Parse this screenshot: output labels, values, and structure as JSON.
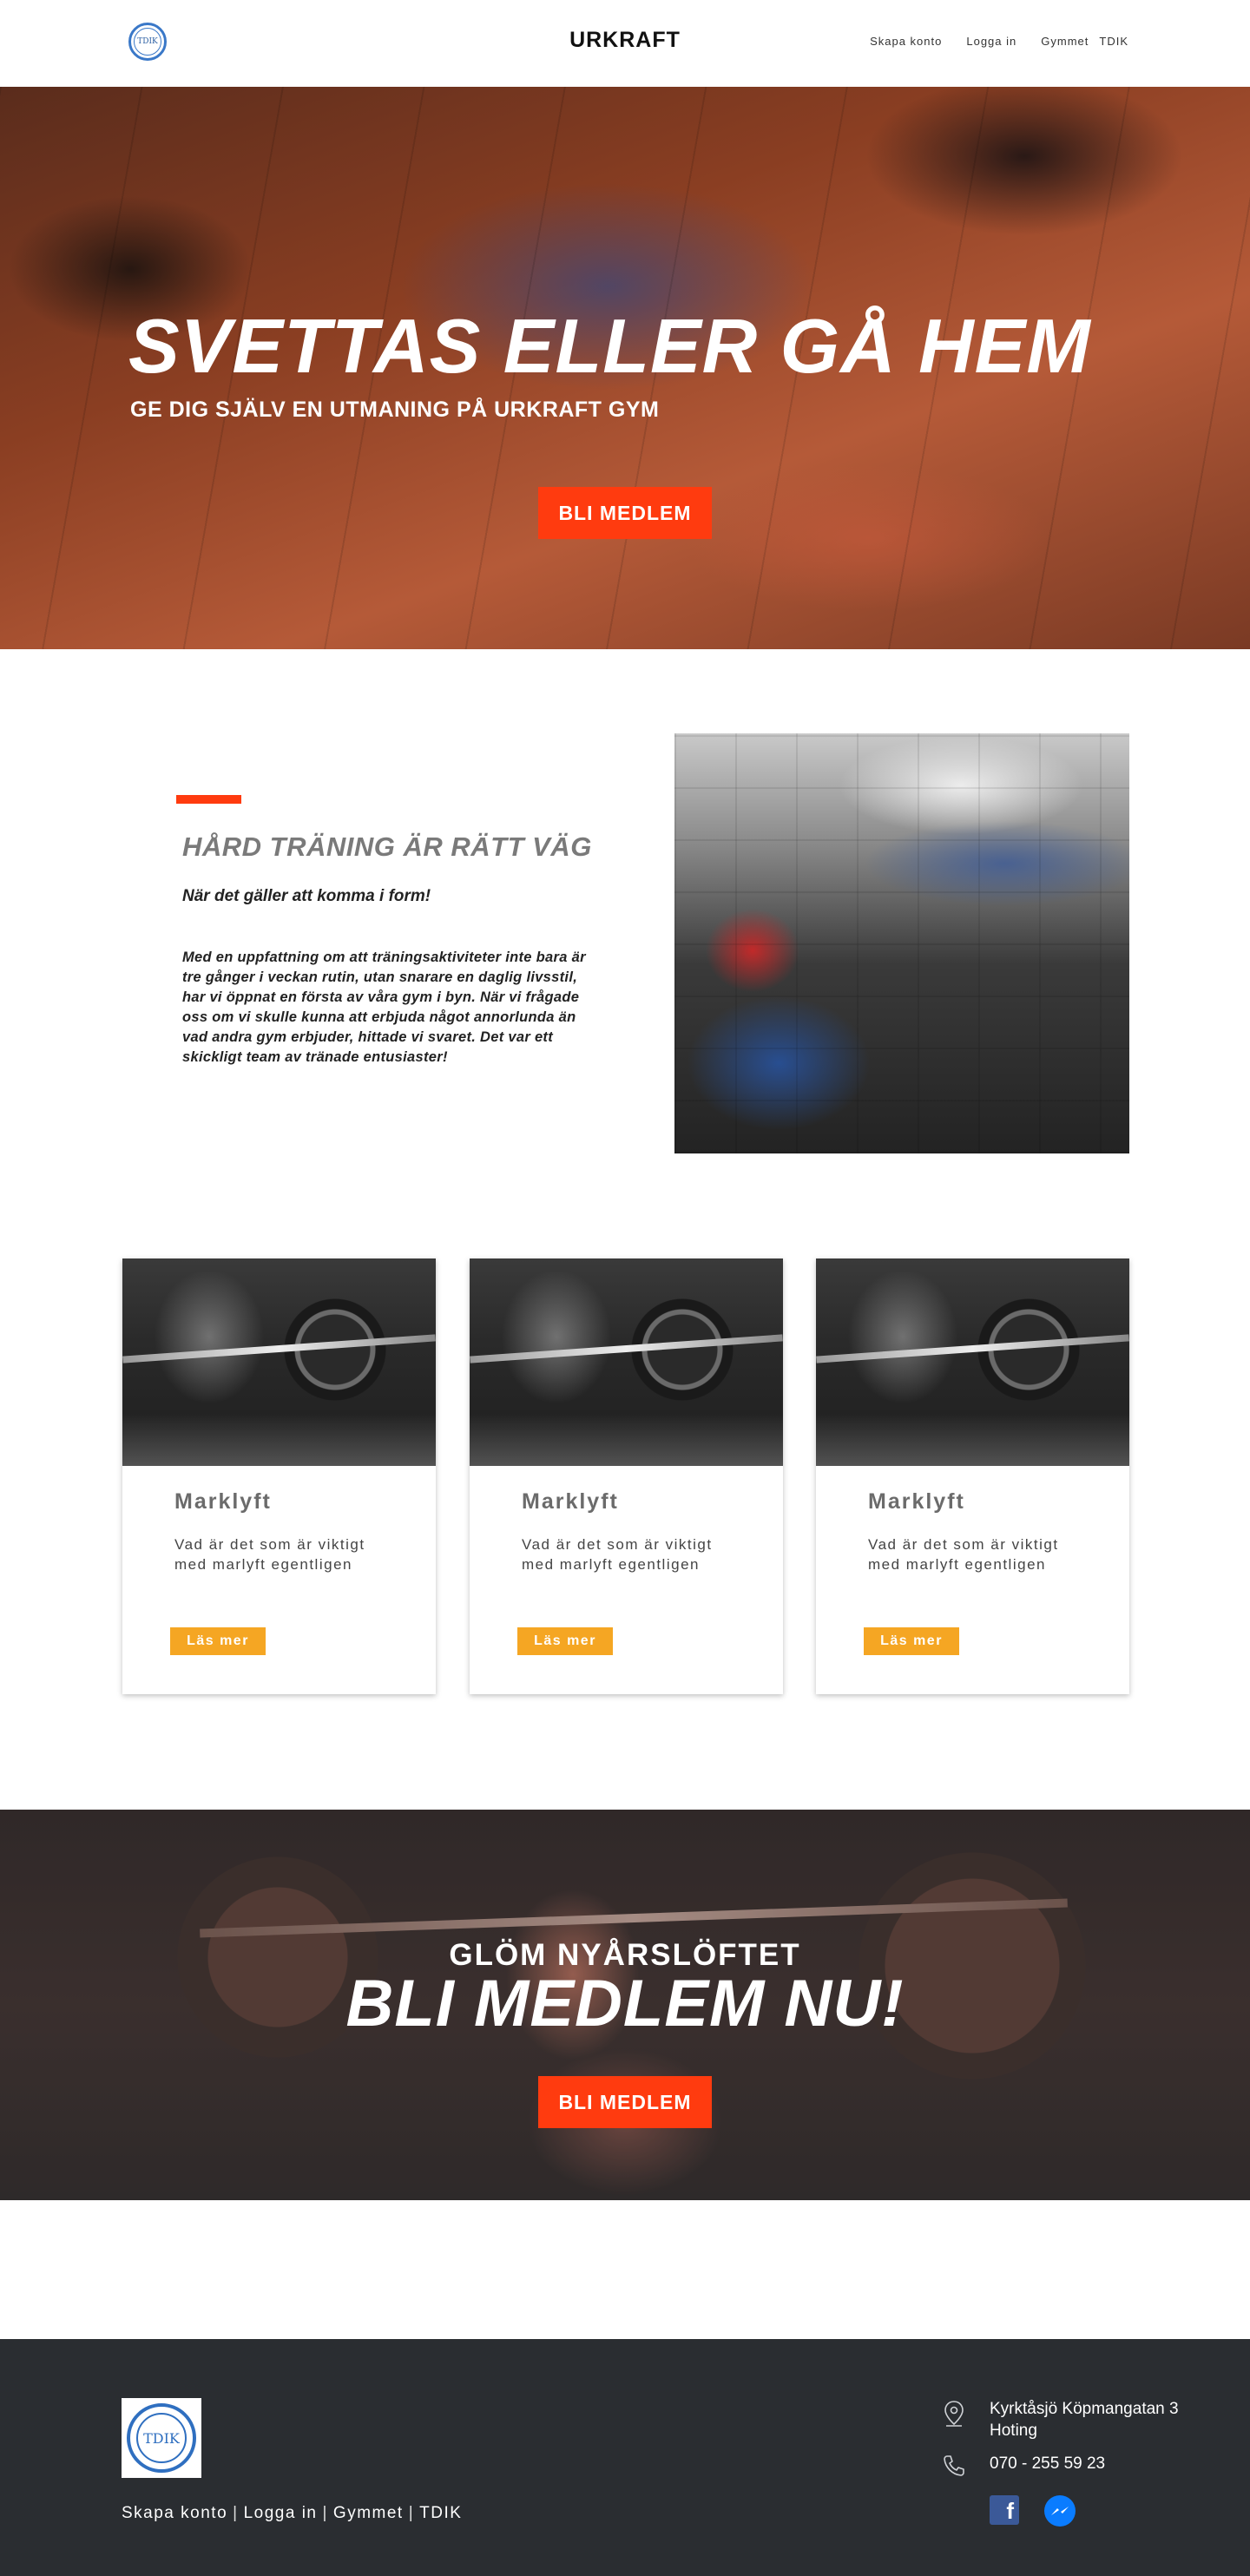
{
  "header": {
    "logo_text": "TDIK",
    "brand": "URKRAFT",
    "nav": [
      "Skapa konto",
      "Logga in",
      "Gymmet",
      "TDIK"
    ]
  },
  "hero": {
    "title": "SVETTAS ELLER GÅ HEM",
    "subtitle": "GE DIG SJÄLV EN UTMANING PÅ URKRAFT GYM",
    "cta": "BLI MEDLEM"
  },
  "about": {
    "title": "HÅRD TRÄNING ÄR RÄTT VÄG",
    "lead": "När det gäller att komma i form!",
    "body": "Med en uppfattning om att träningsaktiviteter inte bara är tre gånger i veckan rutin, utan snarare en daglig livsstil, har vi öppnat en första av våra gym i byn. När vi frågade oss om vi skulle kunna att erbjuda något annorlunda än vad andra gym erbjuder, hittade vi svaret. Det var ett skickligt team av tränade entusiaster!"
  },
  "cards": [
    {
      "title": "Marklyft",
      "text": "Vad är det som är viktigt med marlyft egentligen",
      "button": "Läs mer"
    },
    {
      "title": "Marklyft",
      "text": "Vad är det som är viktigt med marlyft egentligen",
      "button": "Läs mer"
    },
    {
      "title": "Marklyft",
      "text": "Vad är det som är viktigt med marlyft egentligen",
      "button": "Läs mer"
    }
  ],
  "cta": {
    "small": "GLÖM NYÅRSLÖFTET",
    "big": "BLI MEDLEM NU!",
    "button": "BLI MEDLEM"
  },
  "footer": {
    "logo_text": "TDIK",
    "links": [
      "Skapa konto",
      "Logga in",
      "Gymmet",
      "TDIK"
    ],
    "separator": "|",
    "address": "Kyrktåsjö Köpmangatan 3 Hoting",
    "phone": "070 - 255 59 23"
  },
  "colors": {
    "accent_red": "#ff3b0f",
    "accent_orange": "#f5a623",
    "footer_bg": "#2a2d31"
  }
}
